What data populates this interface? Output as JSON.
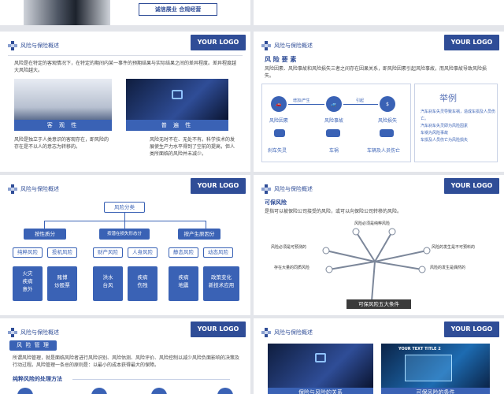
{
  "slide1": {
    "tagline": "诚信展业 合规经营"
  },
  "common": {
    "logo": "YOUR LOGO",
    "section": "风险与保险概述"
  },
  "slide2": {
    "intro": "风险是在特定的客观情况下，在特定的期间内某一事件的预期结果与实际结果之间的差异程度。差异程度越大风险越大。",
    "card1_title": "客 观 性",
    "card1_text": "风险是独立于人类意识的客观存在，即风险的存在是不以人的意志为转移的。",
    "card2_title": "普 遍 性",
    "card2_text": "风险无时不在、无处不有。科学技术的发展使生产力水平得到了空前的提高，但人类所面临的风险并未减少。"
  },
  "slide3": {
    "title": "风 险 要 素",
    "text": "风险因素、风险事故和风险损失三者之间存在因果关系，即风险因素引起风险事故，而风险事故导致风险损失。",
    "arrow1": "增加/产生",
    "arrow2": "引起",
    "nodes": [
      "风险因素",
      "风险事故",
      "风险损失"
    ],
    "examples": [
      "刹车失灵",
      "车祸",
      "车辆及人员伤亡"
    ],
    "example_title": "举例",
    "example_lines": [
      "汽车刹车失灵导致车祸，造成车损及人员伤亡。",
      "汽车刹车失灵即为风险因素",
      "车祸为风险事故",
      "车损及人员伤亡为风险损失"
    ]
  },
  "slide4": {
    "root": "风险分类",
    "groups": [
      {
        "title": "按性质分",
        "items": [
          "纯粹风险",
          "投机风险"
        ],
        "subs": [
          "火灾\n疾病\n意外",
          "赌博\n炒股票"
        ]
      },
      {
        "title": "按潜在损失形态分",
        "items": [
          "财产风险",
          "人身风险"
        ],
        "subs": [
          "洪水\n台风",
          "疾病\n伤残"
        ]
      },
      {
        "title": "按产生原因分",
        "items": [
          "静态风险",
          "动态风险"
        ],
        "subs": [
          "疾病\n地震",
          "政策变化\n新技术应用"
        ]
      }
    ]
  },
  "slide5": {
    "title": "可保风险",
    "text": "是指可以被保险公司接受的风险，或可以向保险公司转移的风险。",
    "labels": [
      "风险必须是纯粹风险",
      "风险必须是可预测的",
      "风险的发生是不可预料的",
      "存在大量的同质风险",
      "风险的发生是偶然的"
    ],
    "base": "可保风险五大条件"
  },
  "slide6": {
    "title": "风 险 管 理",
    "text": "所谓风险管理，就是面临风险者进行风险识别、风险估测、风险评价、风险控制以减少风险负面影响的决策及行动过程。风险管理一条总的原则是：以最小的成本获得最大的保障。",
    "subtitle": "纯粹风险的处理方法"
  },
  "slide7": {
    "photo2_title": "YOUR TEXT TITLE 2",
    "caption1": "保险与风险的关系",
    "caption2": "可保风险的条件"
  }
}
